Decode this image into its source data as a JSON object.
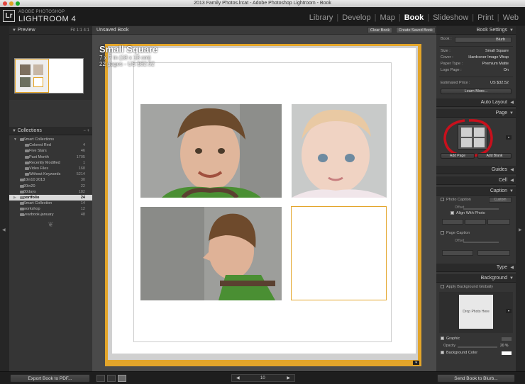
{
  "window": {
    "title": "2013 Family Photos.lrcat - Adobe Photoshop Lightroom - Book"
  },
  "app": {
    "logo": "Lr",
    "brand_small": "ADOBE PHOTOSHOP",
    "brand_big": "LIGHTROOM 4"
  },
  "modules": [
    {
      "label": "Library"
    },
    {
      "label": "Develop"
    },
    {
      "label": "Map"
    },
    {
      "label": "Book",
      "active": true
    },
    {
      "label": "Slideshow"
    },
    {
      "label": "Print"
    },
    {
      "label": "Web"
    }
  ],
  "left": {
    "preview": {
      "title": "Preview",
      "zoom": "Fit  1:1  4:1"
    },
    "collections": {
      "title": "Collections",
      "controls": "−  +",
      "items": [
        {
          "label": "Smart Collections",
          "count": "",
          "level": 0,
          "arrow": "▼"
        },
        {
          "label": "Colored Red",
          "count": "4",
          "level": 1
        },
        {
          "label": "Five Stars",
          "count": "46",
          "level": 1
        },
        {
          "label": "Past Month",
          "count": "1705",
          "level": 1
        },
        {
          "label": "Recently Modified",
          "count": "1",
          "level": 1
        },
        {
          "label": "Video Files",
          "count": "168",
          "level": 1
        },
        {
          "label": "Without Keywords",
          "count": "5214",
          "level": 1
        },
        {
          "label": "10in10 2013",
          "count": "30",
          "level": 0
        },
        {
          "label": "20in20",
          "count": "22",
          "level": 0
        },
        {
          "label": "30days",
          "count": "182",
          "level": 0
        },
        {
          "label": "portfolio",
          "count": "24",
          "level": 0,
          "arrow": "▶",
          "highlight": true
        },
        {
          "label": "Smart Collection",
          "count": "14",
          "level": 0
        },
        {
          "label": "workshop",
          "count": "12",
          "level": 0
        },
        {
          "label": "yearbook-january",
          "count": "48",
          "level": 0
        }
      ]
    },
    "export_button": "Export Book to PDF..."
  },
  "center": {
    "title": "Unsaved Book",
    "clear_button": "Clear Book",
    "create_button": "Create Saved Book",
    "book_name": "Small Square",
    "book_size": "7 x 7 in (18 x 18 cm)",
    "book_pages": "22 pages - US $32.52",
    "page_indicator": "▾",
    "page_number": "10",
    "prev": "◀",
    "next": "▶"
  },
  "right": {
    "book_settings": {
      "title": "Book Settings",
      "book_label": "Book :",
      "book_value": "Blurb",
      "rows": [
        {
          "label": "Size :",
          "value": "Small Square"
        },
        {
          "label": "Cover :",
          "value": "Hardcover Image Wrap"
        },
        {
          "label": "Paper Type :",
          "value": "Premium Matte"
        },
        {
          "label": "Logo Page :",
          "value": "On"
        }
      ],
      "price_label": "Estimated Price :",
      "price_value": "US $32.52",
      "learn_more": "Learn More..."
    },
    "auto_layout": "Auto Layout",
    "page": {
      "title": "Page",
      "add_page": "Add Page",
      "add_blank": "Add Blank"
    },
    "guides": "Guides",
    "cell": "Cell",
    "caption": {
      "title": "Caption",
      "photo_caption": "Photo Caption",
      "custom": "Custom",
      "offset": "Offset",
      "align_with_photo": "Align With Photo",
      "page_caption": "Page Caption"
    },
    "type": "Type",
    "background": {
      "title": "Background",
      "apply_globally": "Apply Background Globally",
      "drop_photo": "Drop Photo Here",
      "graphic": "Graphic",
      "opacity": "Opacity",
      "opacity_value": "20 %",
      "bg_color": "Background Color"
    },
    "send_button": "Send Book to Blurb..."
  },
  "colors": {
    "accent": "#e3a52a",
    "annotation": "#c8101c"
  }
}
